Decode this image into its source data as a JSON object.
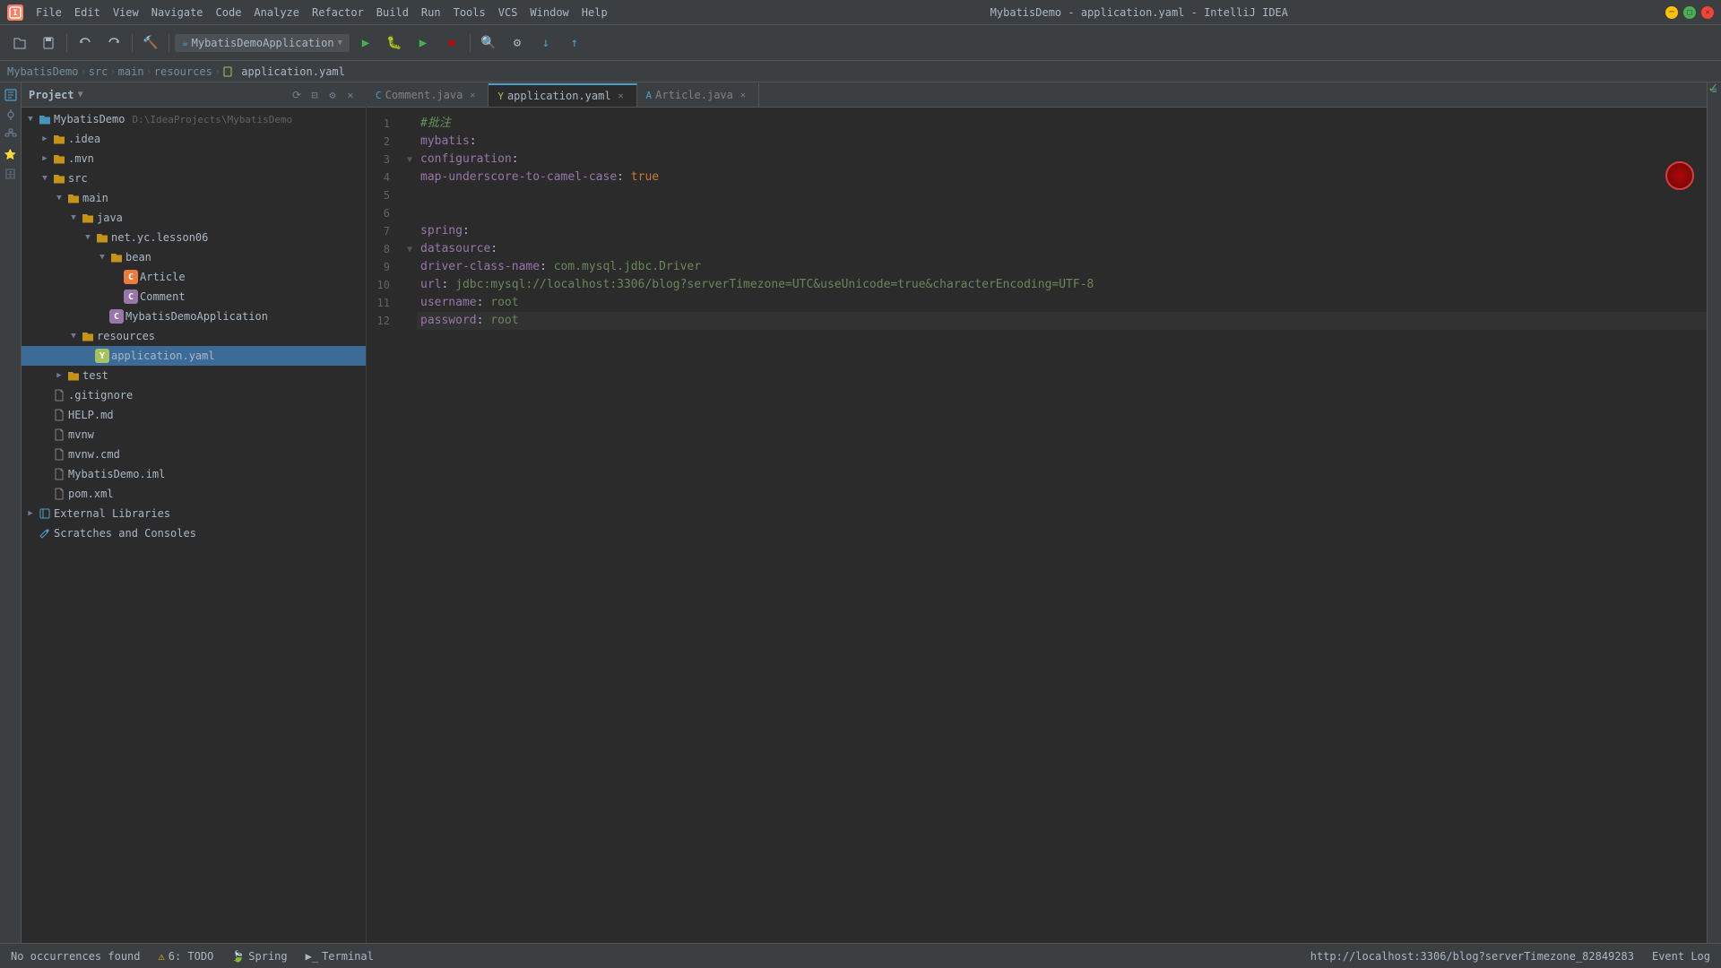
{
  "window": {
    "title": "MybatisDemo - application.yaml - IntelliJ IDEA"
  },
  "menu": {
    "items": [
      "File",
      "Edit",
      "View",
      "Navigate",
      "Code",
      "Analyze",
      "Refactor",
      "Build",
      "Run",
      "Tools",
      "VCS",
      "Window",
      "Help"
    ]
  },
  "breadcrumb": {
    "items": [
      "MybatisDemo",
      "src",
      "main",
      "resources",
      "application.yaml"
    ]
  },
  "tabs": [
    {
      "label": "Comment.java",
      "type": "java",
      "active": false
    },
    {
      "label": "application.yaml",
      "type": "yaml",
      "active": true
    },
    {
      "label": "Article.java",
      "type": "java",
      "active": false
    }
  ],
  "run_config": {
    "label": "MybatisDemoApplication",
    "icon": "▶"
  },
  "project": {
    "title": "Project",
    "root": {
      "name": "MybatisDemo",
      "path": "D:\\IdeaProjects\\MybatisDemo"
    }
  },
  "file_tree": [
    {
      "indent": 0,
      "arrow": "▼",
      "icon": "📁",
      "icon_class": "icon-blue",
      "label": "MybatisDemo",
      "extra": "D:\\IdeaProjects\\MybatisDemo"
    },
    {
      "indent": 1,
      "arrow": "▶",
      "icon": "📁",
      "icon_class": "icon-yellow",
      "label": ".idea"
    },
    {
      "indent": 1,
      "arrow": "▶",
      "icon": "📁",
      "icon_class": "icon-yellow",
      "label": ".mvn"
    },
    {
      "indent": 1,
      "arrow": "▼",
      "icon": "📁",
      "icon_class": "icon-yellow",
      "label": "src"
    },
    {
      "indent": 2,
      "arrow": "▼",
      "icon": "📁",
      "icon_class": "icon-yellow",
      "label": "main"
    },
    {
      "indent": 3,
      "arrow": "▼",
      "icon": "📁",
      "icon_class": "icon-yellow",
      "label": "java"
    },
    {
      "indent": 4,
      "arrow": "▼",
      "icon": "📁",
      "icon_class": "icon-yellow",
      "label": "net.yc.lesson06"
    },
    {
      "indent": 5,
      "arrow": "▼",
      "icon": "📁",
      "icon_class": "icon-yellow",
      "label": "bean"
    },
    {
      "indent": 6,
      "arrow": "",
      "icon": "C",
      "icon_class": "icon-orange",
      "label": "Article"
    },
    {
      "indent": 6,
      "arrow": "",
      "icon": "C",
      "icon_class": "icon-purple",
      "label": "Comment"
    },
    {
      "indent": 5,
      "arrow": "",
      "icon": "C",
      "icon_class": "icon-green",
      "label": "MybatisDemoApplication"
    },
    {
      "indent": 3,
      "arrow": "▼",
      "icon": "📁",
      "icon_class": "icon-yellow",
      "label": "resources"
    },
    {
      "indent": 4,
      "arrow": "",
      "icon": "Y",
      "icon_class": "icon-green",
      "label": "application.yaml",
      "selected": true
    },
    {
      "indent": 2,
      "arrow": "▶",
      "icon": "📁",
      "icon_class": "icon-yellow",
      "label": "test"
    },
    {
      "indent": 1,
      "arrow": "",
      "icon": "📄",
      "icon_class": "icon-gray",
      "label": ".gitignore"
    },
    {
      "indent": 1,
      "arrow": "",
      "icon": "📄",
      "icon_class": "icon-gray",
      "label": "HELP.md"
    },
    {
      "indent": 1,
      "arrow": "",
      "icon": "📄",
      "icon_class": "icon-orange",
      "label": "mvnw"
    },
    {
      "indent": 1,
      "arrow": "",
      "icon": "📄",
      "icon_class": "icon-orange",
      "label": "mvnw.cmd"
    },
    {
      "indent": 1,
      "arrow": "",
      "icon": "📄",
      "icon_class": "icon-blue",
      "label": "MybatisDemo.iml"
    },
    {
      "indent": 1,
      "arrow": "",
      "icon": "📄",
      "icon_class": "icon-orange",
      "label": "pom.xml"
    },
    {
      "indent": 0,
      "arrow": "▶",
      "icon": "📚",
      "icon_class": "icon-blue",
      "label": "External Libraries"
    },
    {
      "indent": 0,
      "arrow": "",
      "icon": "✏",
      "icon_class": "icon-blue",
      "label": "Scratches and Consoles"
    }
  ],
  "code_lines": [
    {
      "num": 1,
      "content": "#批注",
      "type": "comment"
    },
    {
      "num": 2,
      "content": "mybatis:",
      "type": "key"
    },
    {
      "num": 3,
      "content": "  configuration:",
      "type": "key",
      "fold": true
    },
    {
      "num": 4,
      "content": "    map-underscore-to-camel-case: true",
      "type": "mixed"
    },
    {
      "num": 5,
      "content": "",
      "type": "plain"
    },
    {
      "num": 6,
      "content": "",
      "type": "plain"
    },
    {
      "num": 7,
      "content": "spring:",
      "type": "key"
    },
    {
      "num": 8,
      "content": "  datasource:",
      "type": "key",
      "fold": true
    },
    {
      "num": 9,
      "content": "    driver-class-name: com.mysql.jdbc.Driver",
      "type": "mixed"
    },
    {
      "num": 10,
      "content": "    url: jdbc:mysql://localhost:3306/blog?serverTimezone=UTC&useUnicode=true&characterEncoding=UTF-8",
      "type": "mixed"
    },
    {
      "num": 11,
      "content": "    username: root",
      "type": "mixed"
    },
    {
      "num": 12,
      "content": "    password: root",
      "type": "mixed",
      "current": true
    }
  ],
  "status_bar": {
    "left": {
      "no_occurrences": "No occurrences found",
      "todo": "6: TODO",
      "spring": "Spring",
      "terminal": "Terminal"
    },
    "right": {
      "position": "http://localhost:3306/blog?serverTimezone_82849283",
      "event_log": "Event Log"
    }
  }
}
